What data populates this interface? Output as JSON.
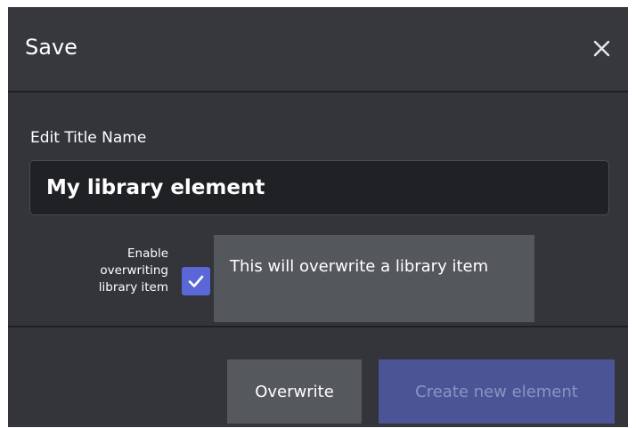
{
  "dialog": {
    "title": "Save",
    "close_icon": "close-icon"
  },
  "form": {
    "field_label": "Edit Title Name",
    "title_value": "My library element",
    "enable_overwrite_label_lines": [
      "Enable",
      "overwriting",
      "library item"
    ],
    "enable_overwrite_checked": true,
    "tooltip_text": "This will overwrite a library item"
  },
  "footer": {
    "overwrite_label": "Overwrite",
    "create_label": "Create new element"
  },
  "colors": {
    "dialog_bg": "#33353a",
    "accent": "#5b66d9",
    "disabled_primary": "#4b5596",
    "secondary_button": "#55585c",
    "tooltip_bg": "#54575b"
  }
}
